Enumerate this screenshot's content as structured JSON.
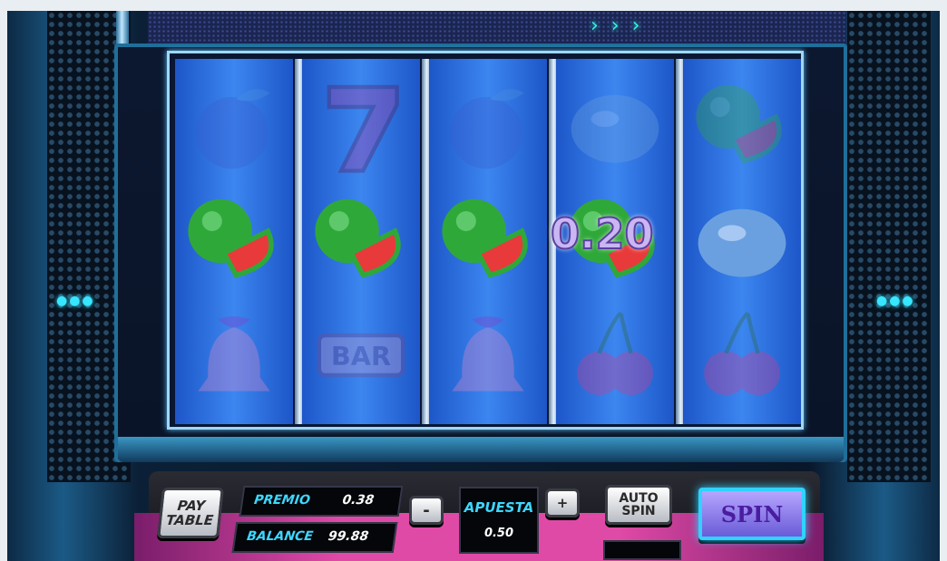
{
  "game": {
    "win_amount": "0.20",
    "colors": {
      "reel_blue": "#2e72e8",
      "accent_cyan": "#3ed7ff",
      "spin_purple": "#8f7ff0",
      "deck_pink": "#e04aa7"
    }
  },
  "reels": [
    {
      "symbols": [
        "plum-icon",
        "watermelon-icon",
        "bell-icon"
      ]
    },
    {
      "symbols": [
        "seven-icon",
        "watermelon-icon",
        "bar-icon"
      ]
    },
    {
      "symbols": [
        "plum-icon",
        "watermelon-icon",
        "bell-icon"
      ]
    },
    {
      "symbols": [
        "lemon-icon",
        "watermelon-icon",
        "cherry-icon"
      ]
    },
    {
      "symbols": [
        "watermelon-icon",
        "lemon-icon",
        "cherry-icon"
      ]
    }
  ],
  "winning_row": 1,
  "controls": {
    "paytable_line1": "PAY",
    "paytable_line2": "TABLE",
    "premio_label": "PREMIO",
    "premio_value": "0.38",
    "balance_label": "BALANCE",
    "balance_value": "99.88",
    "minus_label": "-",
    "apuesta_label": "APUESTA",
    "apuesta_value": "0.50",
    "plus_label": "+",
    "autospin_line1": "AUTO",
    "autospin_line2": "SPIN",
    "spin_label": "SPIN"
  }
}
